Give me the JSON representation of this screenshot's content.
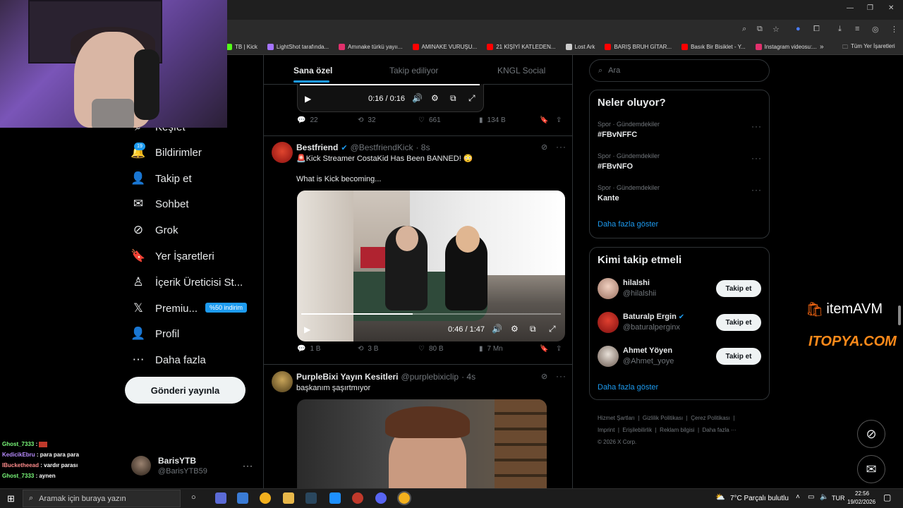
{
  "browser": {
    "bookmarks": [
      {
        "label": "TB | Kick",
        "color": "#53fc18"
      },
      {
        "label": "LightShot tarafında...",
        "color": "#a574ff"
      },
      {
        "label": "Amınake türkü yayıı...",
        "color": "#e1306c"
      },
      {
        "label": "AMINAKE VURUŞU...",
        "color": "#ff0000"
      },
      {
        "label": "21 KİŞİYİ KATLEDEN...",
        "color": "#ff0000"
      },
      {
        "label": "Lost Ark",
        "color": "#cccccc"
      },
      {
        "label": "BARIŞ BRUH GİTAR...",
        "color": "#ff0000"
      },
      {
        "label": "Basık Bir Bisiklet - Y...",
        "color": "#ff0000"
      },
      {
        "label": "Instagram videosu:...",
        "color": "#e1306c"
      }
    ],
    "all_bookmarks": "Tüm Yer İşaretleri",
    "more_chevron": "»"
  },
  "nav": {
    "explore": "Keşfet",
    "notifications_badge": "19",
    "items": [
      {
        "label": "Bildirimler",
        "icon": "bell-icon",
        "glyph": "🔔"
      },
      {
        "label": "Takip et",
        "icon": "follow-icon",
        "glyph": "👤"
      },
      {
        "label": "Sohbet",
        "icon": "mail-icon",
        "glyph": "✉"
      },
      {
        "label": "Grok",
        "icon": "grok-icon",
        "glyph": "⊘"
      },
      {
        "label": "Yer İşaretleri",
        "icon": "bookmark-icon",
        "glyph": "🔖"
      },
      {
        "label": "İçerik Üreticisi St...",
        "icon": "creator-icon",
        "glyph": "♙"
      },
      {
        "label": "Premiu...",
        "icon": "x-logo-icon",
        "glyph": "𝕏"
      },
      {
        "label": "Profil",
        "icon": "profile-icon",
        "glyph": "👤"
      },
      {
        "label": "Daha fazla",
        "icon": "more-circle-icon",
        "glyph": "⋯"
      }
    ],
    "premium_promo": "%50 indirim",
    "post_button": "Gönderi yayınla",
    "account": {
      "name": "BarisYTB",
      "handle": "@BarisYTB59",
      "more": "···"
    }
  },
  "main": {
    "tabs": [
      "Sana özel",
      "Takip ediliyor",
      "KNGL Social"
    ],
    "prev_post": {
      "video_time": "0:16 / 0:16",
      "replies": "22",
      "reposts": "32",
      "likes": "661",
      "views": "134 B"
    },
    "posts": [
      {
        "name": "Bestfriend",
        "handle": "@BestfriendKick",
        "time": "· 8s",
        "text": "🚨Kick Streamer CostaKid Has Been BANNED! 😳",
        "text2": "What is Kick becoming...",
        "video_time": "0:46 / 1:47",
        "video_progress": 0.43,
        "replies": "1 B",
        "reposts": "3 B",
        "likes": "80 B",
        "views": "7 Mn"
      },
      {
        "name": "PurpleBixi Yayın Kesitleri",
        "handle": "@purplebixiclip",
        "time": "· 4s",
        "text": "başkanım şaşırtmıyor"
      }
    ]
  },
  "sidebar": {
    "search_placeholder": "Ara",
    "trends_title": "Neler oluyor?",
    "trends": [
      {
        "category": "Spor · Gündemdekiler",
        "name": "#FBvNFFC"
      },
      {
        "category": "Spor · Gündemdekiler",
        "name": "#FBvNFO"
      },
      {
        "category": "Spor · Gündemdekiler",
        "name": "Kante"
      }
    ],
    "show_more": "Daha fazla göster",
    "who_to_follow_title": "Kimi takip etmeli",
    "follow_label": "Takip et",
    "suggestions": [
      {
        "name": "hilalshi",
        "handle": "@hilalshii",
        "verified": false
      },
      {
        "name": "Baturalp Ergin",
        "handle": "@baturalperginx",
        "verified": true
      },
      {
        "name": "Ahmet Yöyen",
        "handle": "@Ahmet_yoye",
        "verified": false
      }
    ],
    "footer": [
      "Hizmet Şartları",
      "Gizlilik Politikası",
      "Çerez Politikası",
      "Imprint",
      "Erişilebilirlik",
      "Reklam bilgisi",
      "Daha fazla ···",
      "© 2026 X Corp."
    ]
  },
  "overlays": {
    "sponsor1": "itemAVM",
    "sponsor2": "ITOPYA.COM",
    "chat": [
      {
        "user": "Ghost_7333",
        "user_color": "#7cfc7c",
        "msg": ""
      },
      {
        "user": "KedicikEbru",
        "user_color": "#b98cff",
        "msg": "para para para"
      },
      {
        "user": "IBucketheead",
        "user_color": "#ff8c8c",
        "msg": "vardır parası"
      },
      {
        "user": "Ghost_7333",
        "user_color": "#7cfc7c",
        "msg": "aynen"
      }
    ]
  },
  "taskbar": {
    "search_placeholder": "Aramak için buraya yazın",
    "weather": "7°C  Parçalı bulutlu",
    "lang": "TUR",
    "time": "22:56",
    "date": "19/02/2026"
  }
}
